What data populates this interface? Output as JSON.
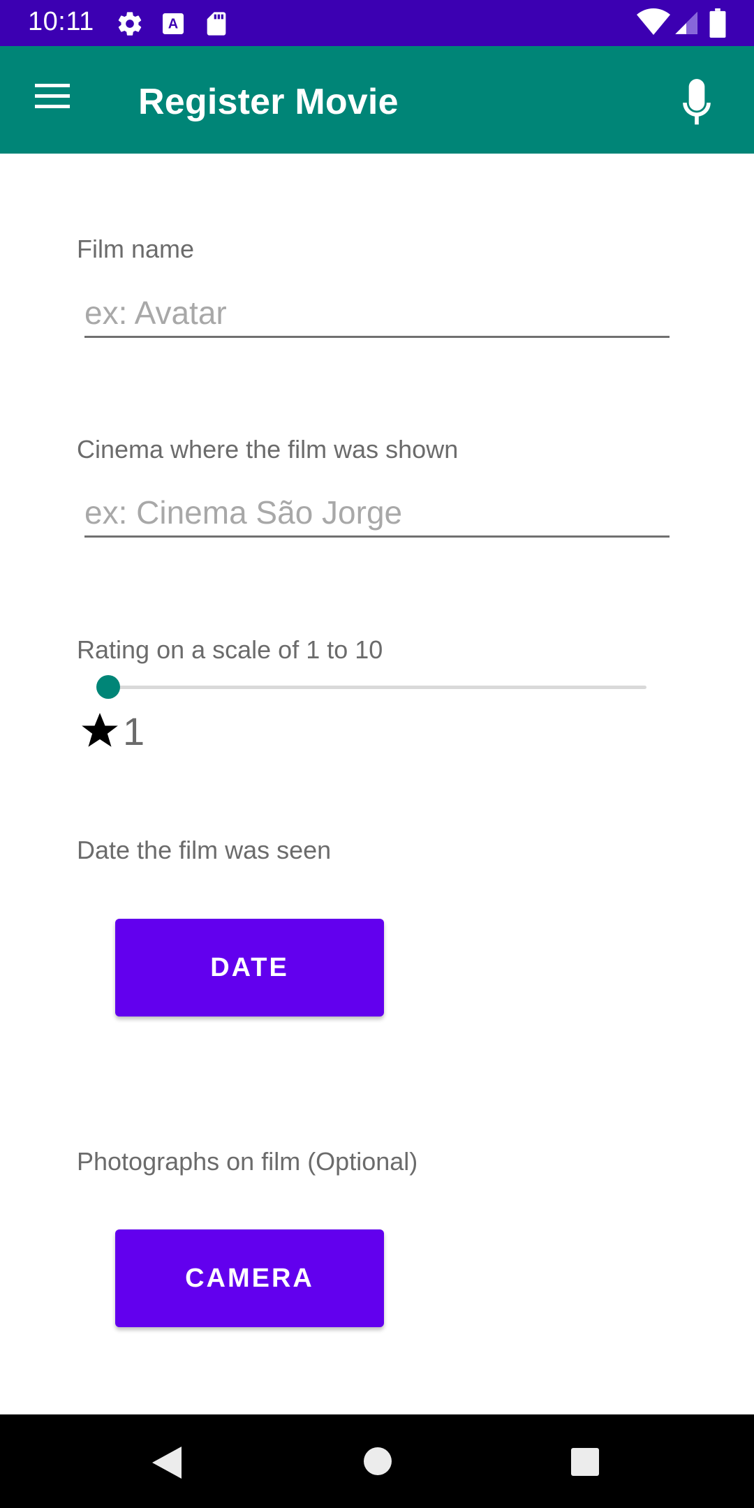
{
  "status_bar": {
    "time": "10:11",
    "icons": [
      "gear-icon",
      "text-a-icon",
      "sd-card-icon",
      "wifi-icon",
      "signal-icon",
      "battery-icon"
    ],
    "background": "#3c00b2"
  },
  "app_bar": {
    "title": "Register Movie",
    "background": "#008577",
    "icons": [
      "menu-icon",
      "microphone-icon"
    ]
  },
  "form": {
    "film_name": {
      "label": "Film name",
      "placeholder": "ex: Avatar",
      "value": ""
    },
    "cinema": {
      "label": "Cinema where the film was shown",
      "placeholder": "ex: Cinema São Jorge",
      "value": ""
    },
    "rating": {
      "label": "Rating on a scale of 1 to 10",
      "value": "1",
      "min": 1,
      "max": 10,
      "star_icon": "star-icon"
    },
    "date": {
      "label": "Date the film was seen",
      "button_label": "DATE"
    },
    "photos": {
      "label": "Photographs on film (Optional)",
      "button_label": "CAMERA"
    }
  },
  "colors": {
    "accent": "#008577",
    "button": "#6200ee",
    "status_bar": "#3c00b2"
  },
  "nav_bar": {
    "icons": [
      "back-icon",
      "home-icon",
      "recent-apps-icon"
    ]
  }
}
